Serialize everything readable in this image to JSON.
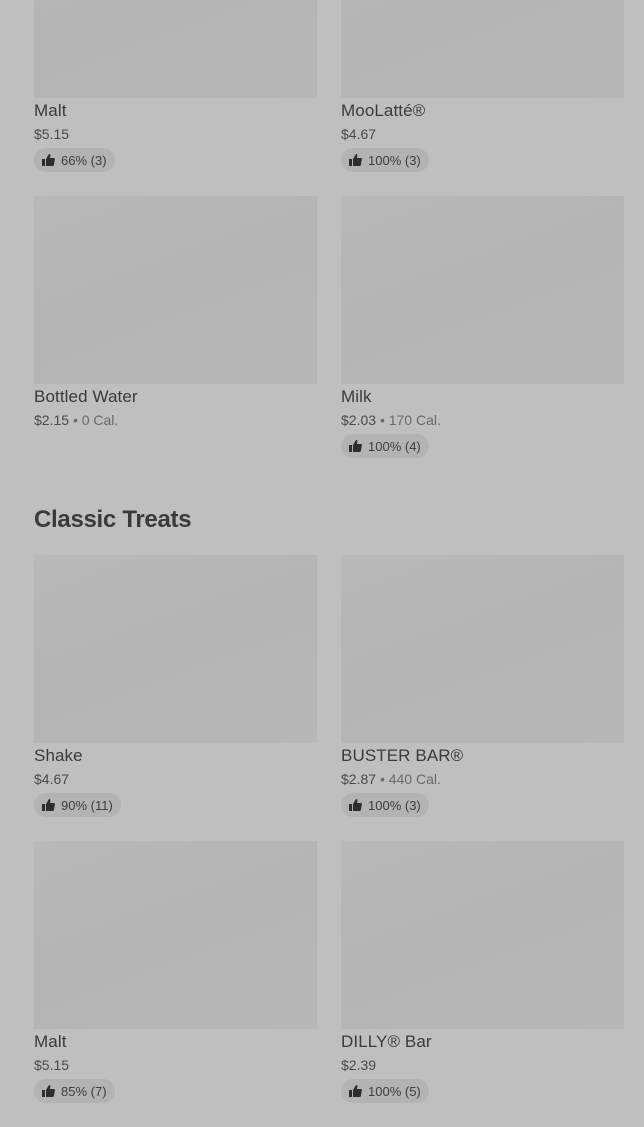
{
  "section_top": {
    "items": [
      {
        "name": "Malt",
        "price": "$5.15",
        "calories": "",
        "rating": "66% (3)"
      },
      {
        "name": "MooLatté®",
        "price": "$4.67",
        "calories": "",
        "rating": "100% (3)"
      },
      {
        "name": "Bottled Water",
        "price": "$2.15",
        "calories": "0 Cal.",
        "rating": ""
      },
      {
        "name": "Milk",
        "price": "$2.03",
        "calories": "170 Cal.",
        "rating": "100% (4)"
      }
    ]
  },
  "classic_treats": {
    "title": "Classic Treats",
    "items": [
      {
        "name": "Shake",
        "price": "$4.67",
        "calories": "",
        "rating": "90% (11)"
      },
      {
        "name": "BUSTER BAR®",
        "price": "$2.87",
        "calories": "440 Cal.",
        "rating": "100% (3)"
      },
      {
        "name": "Malt",
        "price": "$5.15",
        "calories": "",
        "rating": "85% (7)"
      },
      {
        "name": "DILLY® Bar",
        "price": "$2.39",
        "calories": "",
        "rating": "100% (5)"
      }
    ]
  },
  "separator": "•"
}
